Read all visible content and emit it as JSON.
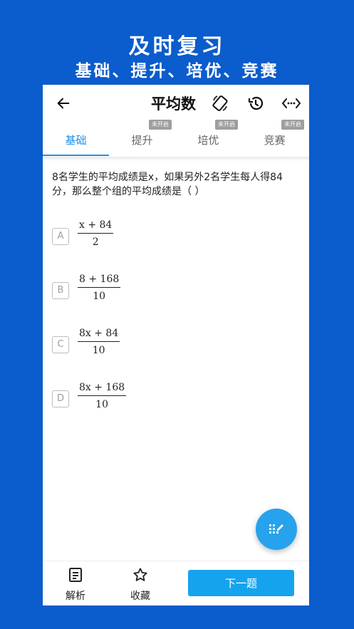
{
  "promo": {
    "line1": "及时复习",
    "line2": "基础、提升、培优、竞赛"
  },
  "appbar": {
    "title": "平均数",
    "icons": [
      "back-arrow-icon",
      "screen-rotate-icon",
      "history-icon",
      "code-icon"
    ]
  },
  "tabs": [
    {
      "label": "基础",
      "badge": ""
    },
    {
      "label": "提升",
      "badge": "未开启"
    },
    {
      "label": "培优",
      "badge": "未开启"
    },
    {
      "label": "竞赛",
      "badge": "未开启"
    }
  ],
  "active_tab": 0,
  "question": {
    "text": "8名学生的平均成绩是x，如果另外2名学生每人得84分，那么整个组的平均成绩是（    ）"
  },
  "options": [
    {
      "letter": "A",
      "numerator": "x + 84",
      "denominator": "2"
    },
    {
      "letter": "B",
      "numerator": "8 + 168",
      "denominator": "10"
    },
    {
      "letter": "C",
      "numerator": "8x + 84",
      "denominator": "10"
    },
    {
      "letter": "D",
      "numerator": "8x + 168",
      "denominator": "10"
    }
  ],
  "bottom": {
    "analysis_label": "解析",
    "favorite_label": "收藏",
    "next_label": "下一题"
  },
  "colors": {
    "background": "#0b5ccc",
    "accent": "#1f8fe6",
    "button": "#16a3ee",
    "fab": "#27a2ec"
  }
}
